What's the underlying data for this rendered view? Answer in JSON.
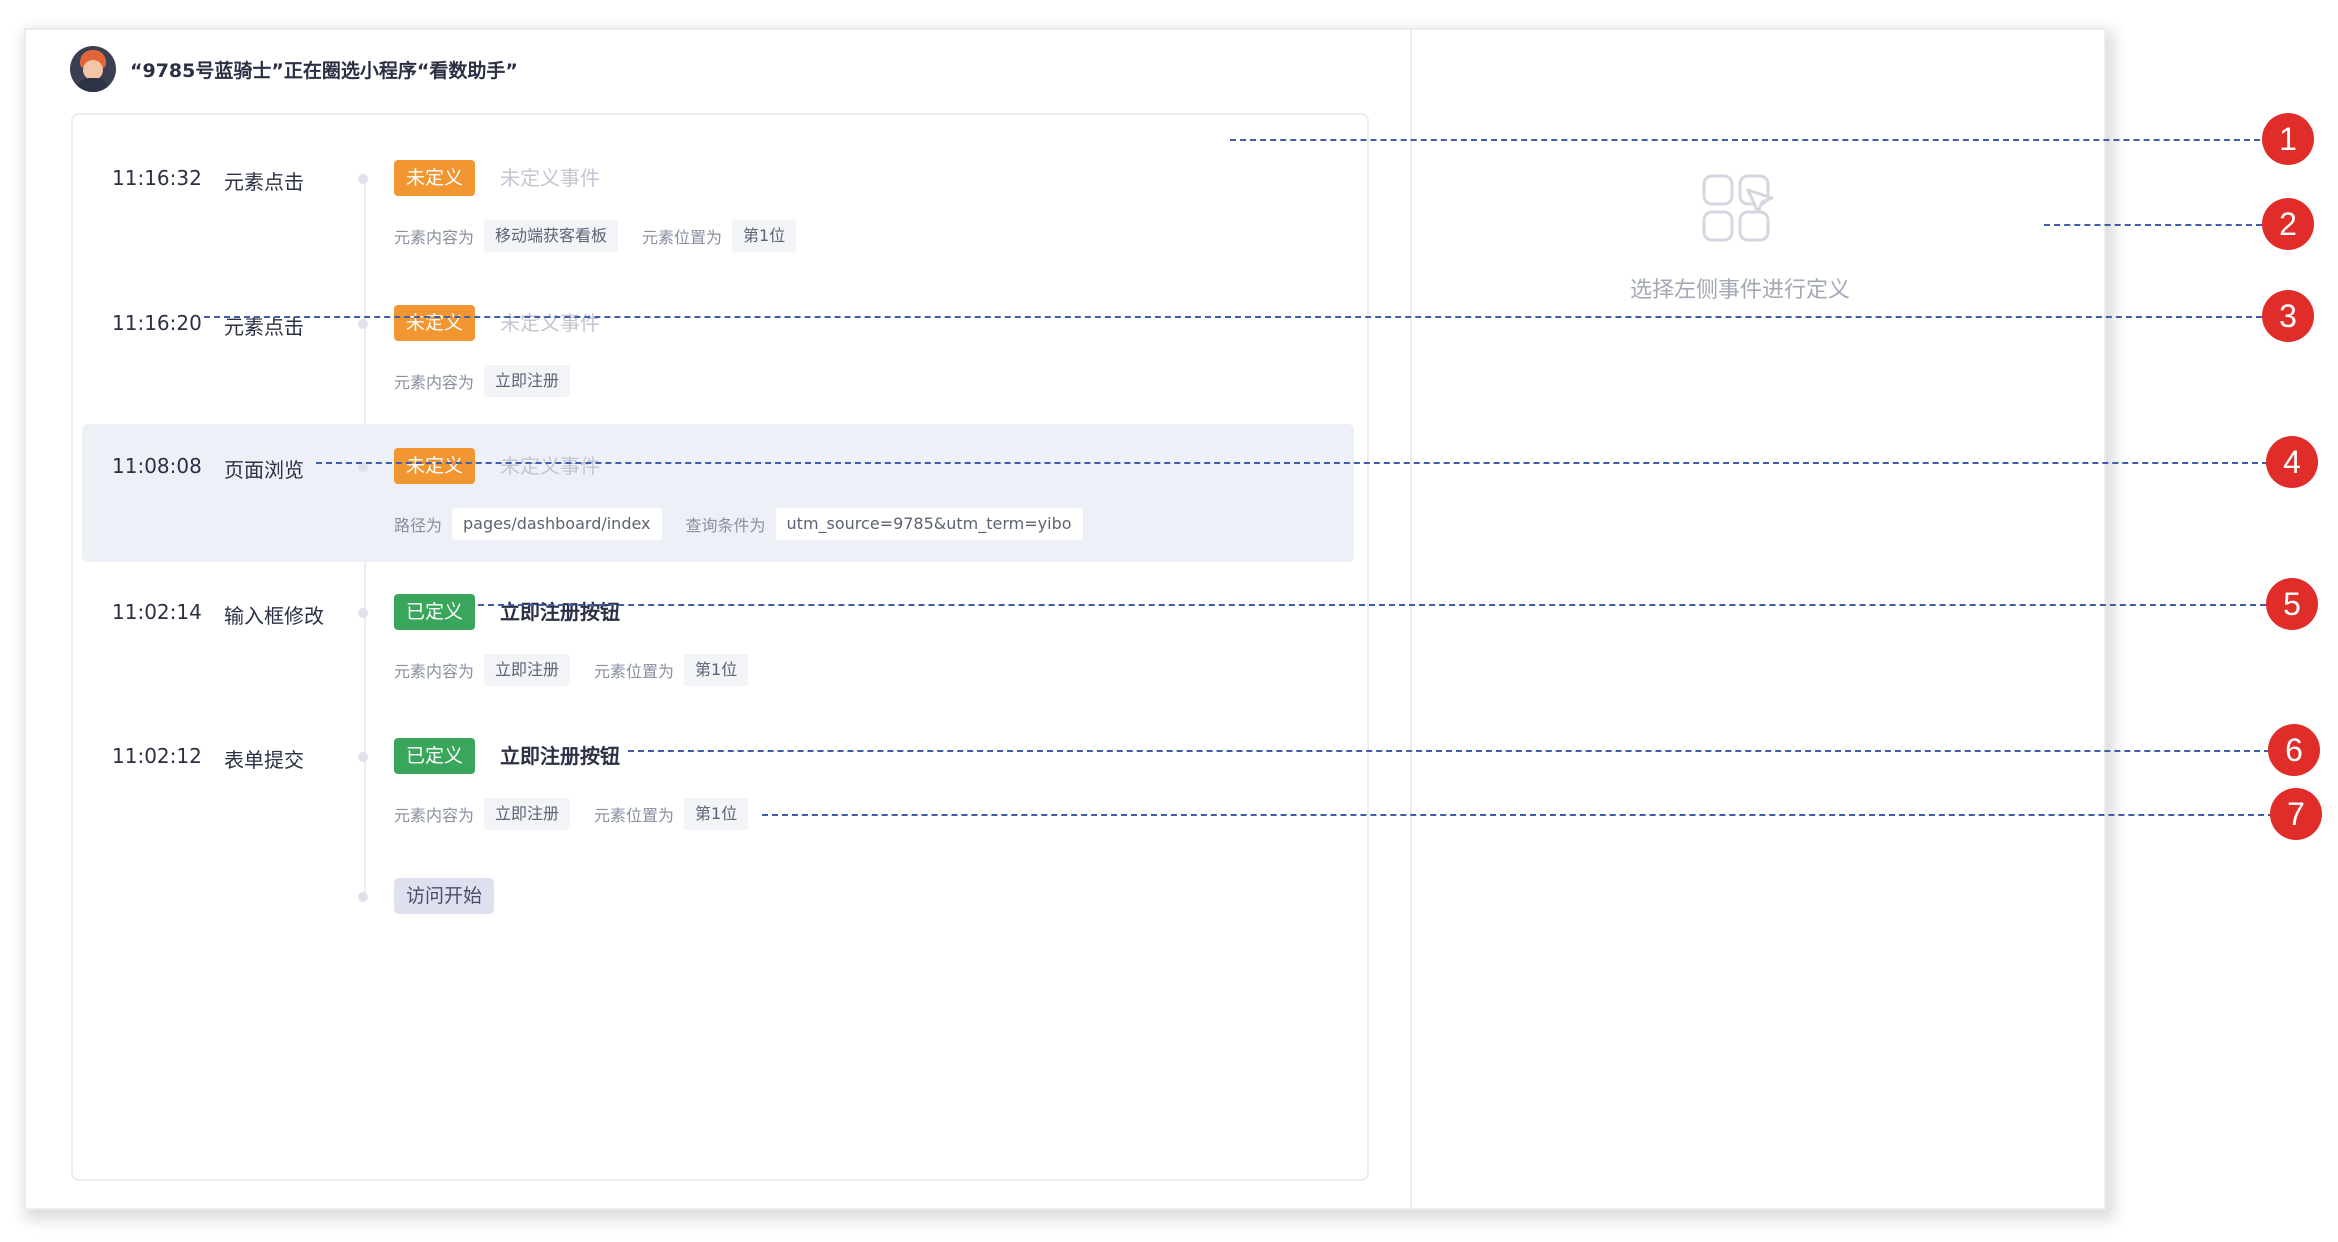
{
  "header": {
    "title": "“9785号蓝骑士”正在圈选小程序“看数助手”"
  },
  "timeline": [
    {
      "time": "11:16:32",
      "type": "元素点击",
      "status": "未定义",
      "name": "未定义事件",
      "attrs": [
        {
          "key": "元素内容为",
          "value": "移动端获客看板"
        },
        {
          "key": "元素位置为",
          "value": "第1位"
        }
      ]
    },
    {
      "time": "11:16:20",
      "type": "元素点击",
      "status": "未定义",
      "name": "未定义事件",
      "attrs": [
        {
          "key": "元素内容为",
          "value": "立即注册"
        }
      ]
    },
    {
      "time": "11:08:08",
      "type": "页面浏览",
      "status": "未定义",
      "name": "未定义事件",
      "attrs": [
        {
          "key": "路径为",
          "value": "pages/dashboard/index"
        },
        {
          "key": "查询条件为",
          "value": "utm_source=9785&utm_term=yibo"
        }
      ]
    },
    {
      "time": "11:02:14",
      "type": "输入框修改",
      "status": "已定义",
      "name": "立即注册按钮",
      "attrs": [
        {
          "key": "元素内容为",
          "value": "立即注册"
        },
        {
          "key": "元素位置为",
          "value": "第1位"
        }
      ]
    },
    {
      "time": "11:02:12",
      "type": "表单提交",
      "status": "已定义",
      "name": "立即注册按钮",
      "attrs": [
        {
          "key": "元素内容为",
          "value": "立即注册"
        },
        {
          "key": "元素位置为",
          "value": "第1位"
        }
      ]
    }
  ],
  "visit_start": "访问开始",
  "right_panel": {
    "empty_text": "选择左侧事件进行定义",
    "icon": "select-event-icon"
  },
  "markers": [
    "1",
    "2",
    "3",
    "4",
    "5",
    "6",
    "7"
  ],
  "colors": {
    "undefined_badge": "#f19630",
    "defined_badge": "#3aa65c",
    "marker": "#e02d2a",
    "callout_line": "#3f5dab",
    "highlight_row": "#eef0f7"
  }
}
